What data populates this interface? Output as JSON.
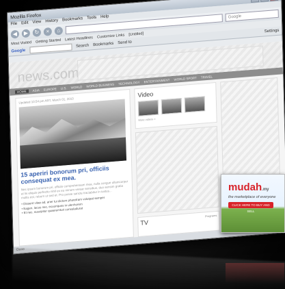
{
  "window": {
    "title": "Mozilla Firefox"
  },
  "menubar": {
    "items": [
      "File",
      "Edit",
      "View",
      "History",
      "Bookmarks",
      "Tools",
      "Help"
    ]
  },
  "toolbar": {
    "search_placeholder": "Google"
  },
  "bookmarks": [
    "Most Visited",
    "Getting Started",
    "Latest Headlines",
    "Customize Links",
    "[Untitled]"
  ],
  "googlebar": {
    "logo": "Google",
    "search_label": "Search",
    "bookmarks_label": "Bookmarks",
    "send_label": "Send to",
    "settings_label": "Settings"
  },
  "site": {
    "logo": "news.com",
    "nav": [
      "HOME",
      "ASIA",
      "EUROPE",
      "U.S.",
      "WORLD",
      "WORLD BUSINESS",
      "TECHNOLOGY",
      "ENTERTAINMENT",
      "WORLD SPORT",
      "TRAVEL"
    ],
    "meta": "Updated 10:54 pm ART, March 01, 2010",
    "headline": "15 aperiri bonorum pri, officiis consequat ex mea.",
    "body": "Nec ipsum bonorum pri, officiis comprehensam mea, nulla congue ullamcorper et lis eliquis perfectio nihil ex eu minum verear sensibus, duo sensim gratia mollis est, rebum ut sed et. Pro posse sancte tractabitur in iustus...",
    "bullets": [
      "Dissent vitae ad, aner tui dictum pharetram volutpat semper",
      "Eagen, lacus nec, ecuoriques in ulenhorem",
      "Et nec, suscipitur quaeremturi consuladurat"
    ],
    "video_title": "Video",
    "more_videos": "More videos »",
    "tv_title": "TV",
    "programs": "Programs"
  },
  "ad": {
    "brand": "mudah",
    "tld": ".my",
    "tagline": "the marketplace of everyone",
    "cta": "CLICK HERE TO BUY AND SELL"
  },
  "statusbar": {
    "text": "Done"
  }
}
